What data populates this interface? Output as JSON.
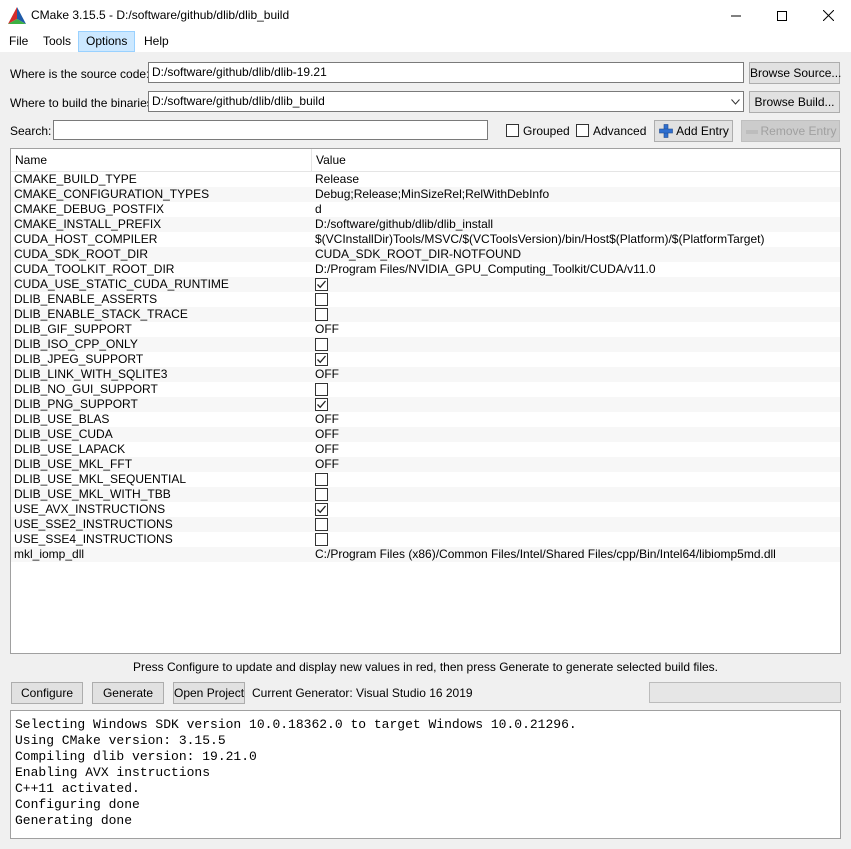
{
  "window": {
    "title": "CMake 3.15.5 - D:/software/github/dlib/dlib_build"
  },
  "menu": [
    "File",
    "Tools",
    "Options",
    "Help"
  ],
  "source": {
    "label": "Where is the source code:",
    "value": "D:/software/github/dlib/dlib-19.21",
    "browse_label": "Browse Source..."
  },
  "build": {
    "label": "Where to build the binaries:",
    "value": "D:/software/github/dlib/dlib_build",
    "browse_label": "Browse Build..."
  },
  "search": {
    "label": "Search:",
    "value": "",
    "grouped_label": "Grouped",
    "grouped_checked": false,
    "advanced_label": "Advanced",
    "advanced_checked": false,
    "add_entry_label": "Add Entry",
    "remove_entry_label": "Remove Entry"
  },
  "table": {
    "col_name": "Name",
    "col_value": "Value",
    "rows": [
      {
        "name": "CMAKE_BUILD_TYPE",
        "type": "text",
        "value": "Release"
      },
      {
        "name": "CMAKE_CONFIGURATION_TYPES",
        "type": "text",
        "value": "Debug;Release;MinSizeRel;RelWithDebInfo"
      },
      {
        "name": "CMAKE_DEBUG_POSTFIX",
        "type": "text",
        "value": "d"
      },
      {
        "name": "CMAKE_INSTALL_PREFIX",
        "type": "text",
        "value": "D:/software/github/dlib/dlib_install"
      },
      {
        "name": "CUDA_HOST_COMPILER",
        "type": "text",
        "value": "$(VCInstallDir)Tools/MSVC/$(VCToolsVersion)/bin/Host$(Platform)/$(PlatformTarget)"
      },
      {
        "name": "CUDA_SDK_ROOT_DIR",
        "type": "text",
        "value": "CUDA_SDK_ROOT_DIR-NOTFOUND"
      },
      {
        "name": "CUDA_TOOLKIT_ROOT_DIR",
        "type": "text",
        "value": "D:/Program Files/NVIDIA_GPU_Computing_Toolkit/CUDA/v11.0"
      },
      {
        "name": "CUDA_USE_STATIC_CUDA_RUNTIME",
        "type": "check",
        "value": true
      },
      {
        "name": "DLIB_ENABLE_ASSERTS",
        "type": "check",
        "value": false
      },
      {
        "name": "DLIB_ENABLE_STACK_TRACE",
        "type": "check",
        "value": false
      },
      {
        "name": "DLIB_GIF_SUPPORT",
        "type": "text",
        "value": "OFF"
      },
      {
        "name": "DLIB_ISO_CPP_ONLY",
        "type": "check",
        "value": false
      },
      {
        "name": "DLIB_JPEG_SUPPORT",
        "type": "check",
        "value": true
      },
      {
        "name": "DLIB_LINK_WITH_SQLITE3",
        "type": "text",
        "value": "OFF"
      },
      {
        "name": "DLIB_NO_GUI_SUPPORT",
        "type": "check",
        "value": false
      },
      {
        "name": "DLIB_PNG_SUPPORT",
        "type": "check",
        "value": true
      },
      {
        "name": "DLIB_USE_BLAS",
        "type": "text",
        "value": "OFF"
      },
      {
        "name": "DLIB_USE_CUDA",
        "type": "text",
        "value": "OFF"
      },
      {
        "name": "DLIB_USE_LAPACK",
        "type": "text",
        "value": "OFF"
      },
      {
        "name": "DLIB_USE_MKL_FFT",
        "type": "text",
        "value": "OFF"
      },
      {
        "name": "DLIB_USE_MKL_SEQUENTIAL",
        "type": "check",
        "value": false
      },
      {
        "name": "DLIB_USE_MKL_WITH_TBB",
        "type": "check",
        "value": false
      },
      {
        "name": "USE_AVX_INSTRUCTIONS",
        "type": "check",
        "value": true
      },
      {
        "name": "USE_SSE2_INSTRUCTIONS",
        "type": "check",
        "value": false
      },
      {
        "name": "USE_SSE4_INSTRUCTIONS",
        "type": "check",
        "value": false
      },
      {
        "name": "mkl_iomp_dll",
        "type": "text",
        "value": "C:/Program Files (x86)/Common Files/Intel/Shared Files/cpp/Bin/Intel64/libiomp5md.dll"
      }
    ]
  },
  "hint": "Press Configure to update and display new values in red, then press Generate to generate selected build files.",
  "actions": {
    "configure_label": "Configure",
    "generate_label": "Generate",
    "open_project_label": "Open Project",
    "generator_text": "Current Generator: Visual Studio 16 2019"
  },
  "output_lines": [
    "Selecting Windows SDK version 10.0.18362.0 to target Windows 10.0.21296.",
    "Using CMake version: 3.15.5",
    "Compiling dlib version: 19.21.0",
    "Enabling AVX instructions",
    "C++11 activated.",
    "Configuring done",
    "Generating done"
  ],
  "colors": {
    "accent_blue": "#1e5aa8",
    "menu_highlight": "#cce8ff"
  },
  "icons": {
    "app": "cmake-logo-icon",
    "minimize": "minimize-icon",
    "maximize": "maximize-icon",
    "close": "close-icon",
    "add": "plus-icon"
  }
}
